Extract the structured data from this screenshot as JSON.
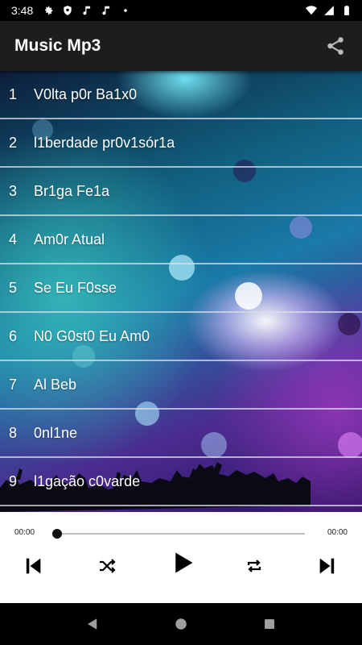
{
  "status_bar": {
    "time": "3:48",
    "left_icons": [
      "gear-icon",
      "shield-icon",
      "music-note-icon",
      "music-note-icon",
      "dot-icon"
    ],
    "right_icons": [
      "wifi-icon",
      "signal-icon",
      "battery-icon"
    ]
  },
  "app_bar": {
    "title": "Music Mp3",
    "action_icon": "share-icon"
  },
  "tracks": [
    {
      "num": "1",
      "title": "V0lta p0r Ba1x0"
    },
    {
      "num": "2",
      "title": "l1berdade pr0v1sór1a"
    },
    {
      "num": "3",
      "title": "Br1ga Fe1a"
    },
    {
      "num": "4",
      "title": "Am0r Atual"
    },
    {
      "num": "5",
      "title": "Se Eu F0sse"
    },
    {
      "num": "6",
      "title": "N0 G0st0 Eu Am0"
    },
    {
      "num": "7",
      "title": "Al Beb"
    },
    {
      "num": "8",
      "title": "0nl1ne"
    },
    {
      "num": "9",
      "title": "l1gação c0varde"
    }
  ],
  "player": {
    "current_time": "00:00",
    "total_time": "00:00",
    "progress": 0,
    "controls": [
      "previous-icon",
      "shuffle-icon",
      "play-icon",
      "repeat-icon",
      "next-icon"
    ]
  },
  "nav_bar": {
    "buttons": [
      "back-icon",
      "home-icon",
      "recents-icon"
    ]
  },
  "colors": {
    "app_bar": "#1d1d1d",
    "player_bg": "#ffffff",
    "divider": "#dcdce6"
  }
}
